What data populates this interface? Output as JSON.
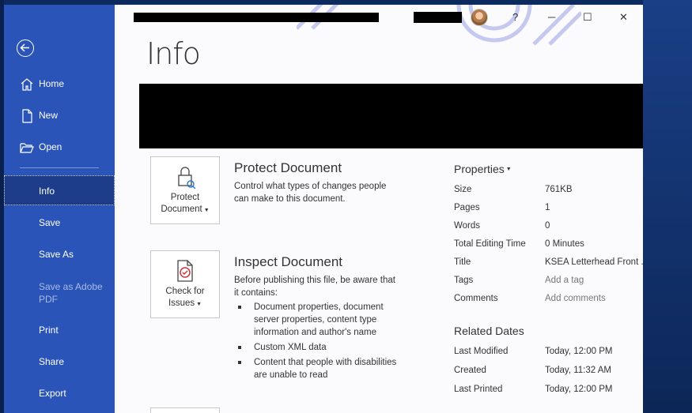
{
  "nav": {
    "items": [
      {
        "label": "Home",
        "icon": "home-icon"
      },
      {
        "label": "New",
        "icon": "new-document-icon"
      },
      {
        "label": "Open",
        "icon": "folder-open-icon"
      },
      {
        "label": "Info"
      },
      {
        "label": "Save"
      },
      {
        "label": "Save As"
      },
      {
        "label": "Save as Adobe PDF"
      },
      {
        "label": "Print"
      },
      {
        "label": "Share"
      },
      {
        "label": "Export"
      }
    ],
    "active": "Info"
  },
  "titlebar": {
    "help": "?",
    "minimize": "─",
    "maximize": "☐",
    "close": "✕"
  },
  "page": {
    "title": "Info"
  },
  "protect": {
    "tile_line1": "Protect",
    "tile_line2": "Document",
    "title": "Protect Document",
    "description": "Control what types of changes people can make to this document."
  },
  "inspect": {
    "tile_line1": "Check for",
    "tile_line2": "Issues",
    "title": "Inspect Document",
    "description": "Before publishing this file, be aware that it contains:",
    "bullets": [
      "Document properties, document server properties, content type information and author's name",
      "Custom XML data",
      "Content that people with disabilities are unable to read"
    ]
  },
  "properties": {
    "header": "Properties",
    "rows": [
      {
        "key": "Size",
        "value": "761KB"
      },
      {
        "key": "Pages",
        "value": "1"
      },
      {
        "key": "Words",
        "value": "0"
      },
      {
        "key": "Total Editing Time",
        "value": "0 Minutes"
      },
      {
        "key": "Title",
        "value": "KSEA Letterhead Front ..."
      },
      {
        "key": "Tags",
        "value": "Add a tag"
      },
      {
        "key": "Comments",
        "value": "Add comments"
      }
    ]
  },
  "related_dates": {
    "header": "Related Dates",
    "rows": [
      {
        "key": "Last Modified",
        "value": "Today, 12:00 PM"
      },
      {
        "key": "Created",
        "value": "Today, 11:32 AM"
      },
      {
        "key": "Last Printed",
        "value": "Today, 12:00 PM"
      }
    ]
  },
  "colors": {
    "sidebar": "#2b54b9",
    "sidebar_active": "#1d3d8b",
    "accent": "#2b579a"
  }
}
